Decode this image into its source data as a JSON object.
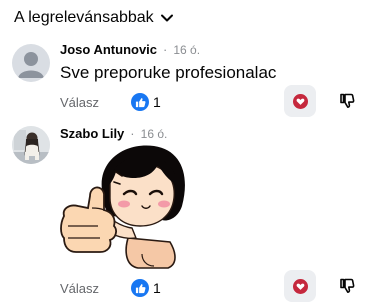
{
  "sort": {
    "label": "A legrelevánsabbak"
  },
  "comments": [
    {
      "author": "Joso Antunovic",
      "separator": "·",
      "time": "16 ó.",
      "text": "Sve preporuke profesionalac",
      "reply_label": "Válasz",
      "reaction_count": "1"
    },
    {
      "author": "Szabo Lily",
      "separator": "·",
      "time": "16 ó.",
      "reply_label": "Válasz",
      "reaction_count": "1"
    }
  ],
  "colors": {
    "like_blue": "#1877f2",
    "heart_red": "#c5283d",
    "button_bg": "#eceef1",
    "muted_text": "#65676b"
  }
}
